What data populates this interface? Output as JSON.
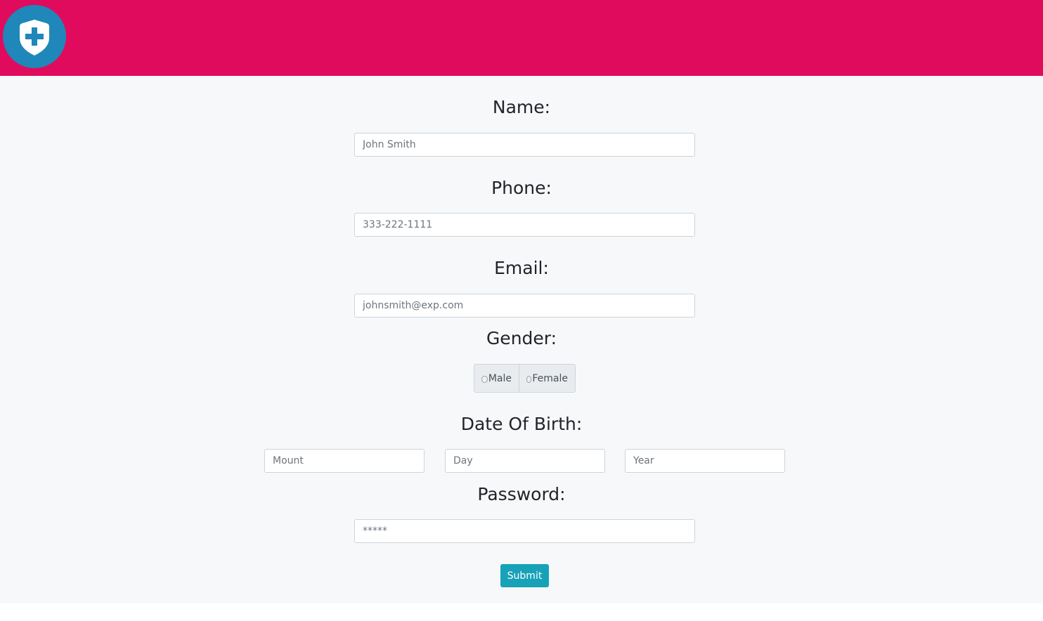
{
  "header": {
    "brand_color": "#e00b5d",
    "logo_icon": "shield-plus-icon",
    "logo_color": "#1f87b9"
  },
  "form": {
    "name": {
      "label": "Name:",
      "placeholder": "John Smith"
    },
    "phone": {
      "label": "Phone:",
      "placeholder": "333-222-1111"
    },
    "email": {
      "label": "Email:",
      "placeholder": "johnsmith@exp.com"
    },
    "gender": {
      "label": "Gender:",
      "options": [
        "Male",
        "Female"
      ]
    },
    "dob": {
      "label": "Date Of Birth:",
      "month_placeholder": "Mount",
      "day_placeholder": "Day",
      "year_placeholder": "Year"
    },
    "password": {
      "label": "Password:",
      "placeholder": "*****"
    },
    "submit_label": "Submit",
    "submit_color": "#17a2b8"
  }
}
